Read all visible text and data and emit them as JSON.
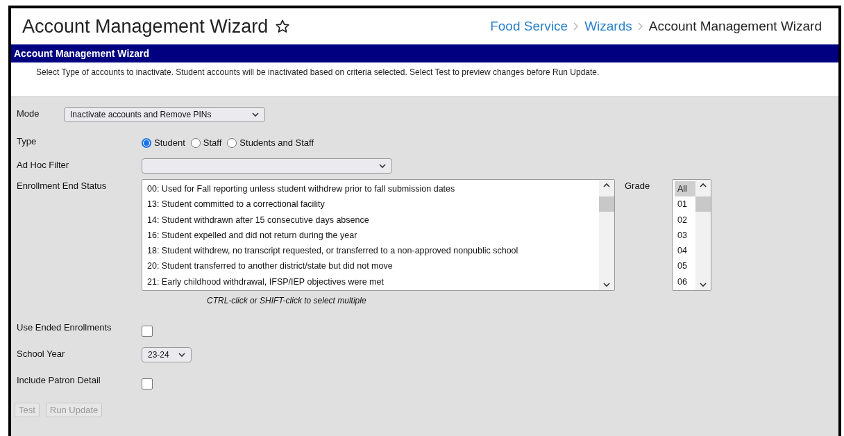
{
  "header": {
    "title": "Account Management Wizard",
    "favorite": false,
    "breadcrumbs": [
      {
        "label": "Food Service",
        "kind": "link"
      },
      {
        "label": "Wizards",
        "kind": "link"
      },
      {
        "label": "Account Management Wizard",
        "kind": "current"
      }
    ]
  },
  "banner": {
    "title": "Account Management Wizard",
    "description": "Select Type of accounts to inactivate. Student accounts will be inactivated based on criteria selected. Select Test to preview changes before Run Update."
  },
  "mode": {
    "label": "Mode",
    "value": "Inactivate accounts and Remove PINs"
  },
  "type": {
    "label": "Type",
    "options": [
      {
        "label": "Student",
        "selected": true
      },
      {
        "label": "Staff",
        "selected": false
      },
      {
        "label": "Students and Staff",
        "selected": false
      }
    ]
  },
  "ad_hoc_filter": {
    "label": "Ad Hoc Filter"
  },
  "enrollment_end_status": {
    "label": "Enrollment End Status",
    "hint": "CTRL-click or SHIFT-click to select multiple",
    "options": [
      {
        "label": "00: Used for Fall reporting unless student withdrew prior to fall submission dates",
        "selected": false
      },
      {
        "label": "13: Student committed to a correctional facility",
        "selected": false
      },
      {
        "label": "14: Student withdrawn after 15 consecutive days absence",
        "selected": false
      },
      {
        "label": "16: Student expelled and did not return during the year",
        "selected": false
      },
      {
        "label": "18: Student withdrew, no transcript requested, or transferred to a non-approved nonpublic school",
        "selected": false
      },
      {
        "label": "20: Student transferred to another district/state but did not move",
        "selected": false
      },
      {
        "label": "21: Early childhood withdrawal, IFSP/IEP objectives were met",
        "selected": false
      }
    ]
  },
  "grade": {
    "label": "Grade",
    "options": [
      {
        "label": "All",
        "selected": true
      },
      {
        "label": "01",
        "selected": false
      },
      {
        "label": "02",
        "selected": false
      },
      {
        "label": "03",
        "selected": false
      },
      {
        "label": "04",
        "selected": false
      },
      {
        "label": "05",
        "selected": false
      },
      {
        "label": "06",
        "selected": false
      }
    ]
  },
  "use_ended_enrollments": {
    "label": "Use Ended Enrollments",
    "checked": false
  },
  "school_year": {
    "label": "School Year",
    "value": "23-24"
  },
  "include_patron_detail": {
    "label": "Include Patron Detail",
    "checked": false
  },
  "buttons": [
    {
      "label": "Test",
      "disabled": true
    },
    {
      "label": "Run Update",
      "disabled": true
    }
  ]
}
